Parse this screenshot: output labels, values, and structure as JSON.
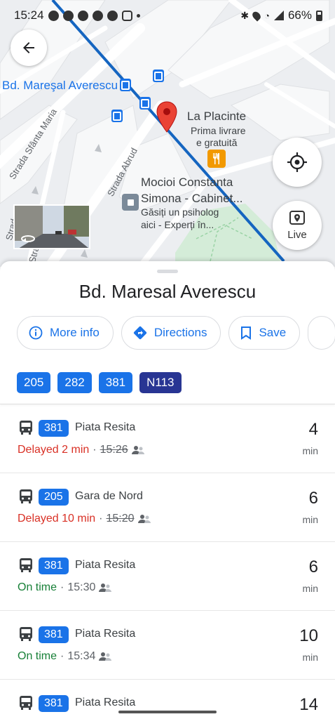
{
  "status_bar": {
    "time": "15:24",
    "battery": "66%"
  },
  "map": {
    "main_street": "Bd. Mareşal Averescu",
    "streets": [
      "Strada Sfânta Maria",
      "Strada Abrud",
      "Strad",
      "Strada"
    ],
    "poi1": {
      "name": "La Placinte",
      "sub1": "Prima livrare",
      "sub2": "e gratuită"
    },
    "poi2": {
      "name1": "Mocioi Constanta",
      "name2": "Simona - Cabinet...",
      "sub1": "Găsiți un psiholog",
      "sub2": "aici - Experți în..."
    },
    "live_label": "Live",
    "colors": {
      "transit_line": "#1565c0",
      "pin": "#ea4335",
      "food_marker": "#f29900"
    }
  },
  "sheet": {
    "title": "Bd. Maresal Averescu",
    "actions": [
      {
        "label": "More info",
        "icon": "info-icon"
      },
      {
        "label": "Directions",
        "icon": "directions-icon"
      },
      {
        "label": "Save",
        "icon": "bookmark-icon"
      }
    ],
    "routes": [
      "205",
      "282",
      "381",
      "N113"
    ],
    "departures": [
      {
        "route": "381",
        "destination": "Piata Resita",
        "status": "Delayed 2 min",
        "kind": "delayed",
        "scheduled": "15:26",
        "minutes": "4",
        "unit": "min"
      },
      {
        "route": "205",
        "destination": "Gara de Nord",
        "status": "Delayed 10 min",
        "kind": "delayed",
        "scheduled": "15:20",
        "minutes": "6",
        "unit": "min"
      },
      {
        "route": "381",
        "destination": "Piata Resita",
        "status": "On time",
        "kind": "ontime",
        "scheduled": "15:30",
        "minutes": "6",
        "unit": "min"
      },
      {
        "route": "381",
        "destination": "Piata Resita",
        "status": "On time",
        "kind": "ontime",
        "scheduled": "15:34",
        "minutes": "10",
        "unit": "min"
      },
      {
        "route": "381",
        "destination": "Piata Resita",
        "status": "",
        "kind": "partial",
        "scheduled": "",
        "minutes": "14",
        "unit": ""
      }
    ],
    "separator": "·"
  }
}
